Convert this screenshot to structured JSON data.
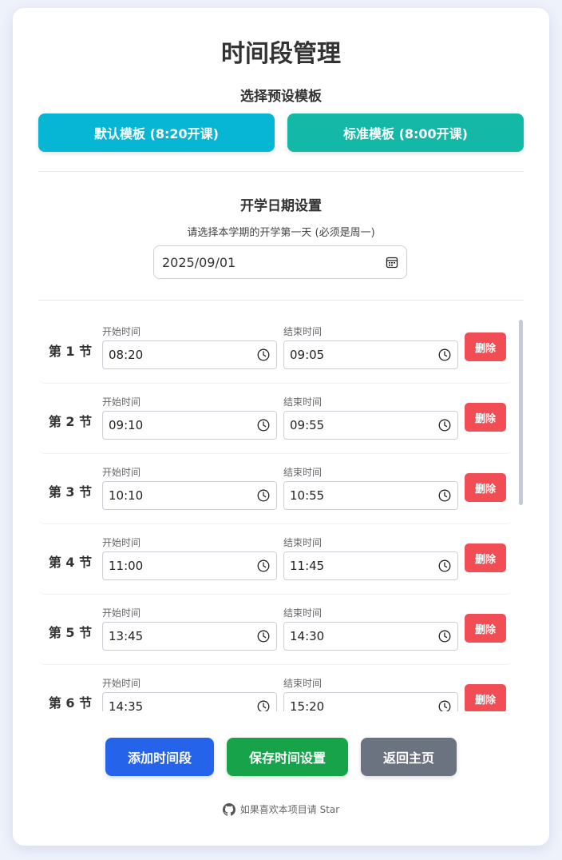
{
  "page": {
    "title": "时间段管理"
  },
  "templates": {
    "heading": "选择预设模板",
    "default_label": "默认模板 (8:20开课)",
    "standard_label": "标准模板 (8:00开课)",
    "default_color": "#06b6d4",
    "standard_color": "#14b8a6"
  },
  "start_date": {
    "heading": "开学日期设置",
    "hint": "请选择本学期的开学第一天 (必须是周一)",
    "value": "2025/09/01",
    "icon": "calendar-icon"
  },
  "periods": [
    {
      "label": "第 1 节",
      "start_label": "开始时间",
      "start": "08:20",
      "end_label": "结束时间",
      "end": "09:05",
      "delete_label": "删除"
    },
    {
      "label": "第 2 节",
      "start_label": "开始时间",
      "start": "09:10",
      "end_label": "结束时间",
      "end": "09:55",
      "delete_label": "删除"
    },
    {
      "label": "第 3 节",
      "start_label": "开始时间",
      "start": "10:10",
      "end_label": "结束时间",
      "end": "10:55",
      "delete_label": "删除"
    },
    {
      "label": "第 4 节",
      "start_label": "开始时间",
      "start": "11:00",
      "end_label": "结束时间",
      "end": "11:45",
      "delete_label": "删除"
    },
    {
      "label": "第 5 节",
      "start_label": "开始时间",
      "start": "13:45",
      "end_label": "结束时间",
      "end": "14:30",
      "delete_label": "删除"
    },
    {
      "label": "第 6 节",
      "start_label": "开始时间",
      "start": "14:35",
      "end_label": "结束时间",
      "end": "15:20",
      "delete_label": "删除"
    }
  ],
  "actions": {
    "add_label": "添加时间段",
    "save_label": "保存时间设置",
    "home_label": "返回主页",
    "add_color": "#2563eb",
    "save_color": "#16a34a",
    "home_color": "#6b7280",
    "delete_color": "#f14d55"
  },
  "footer": {
    "text": "如果喜欢本项目请 Star",
    "icon": "github-icon"
  }
}
